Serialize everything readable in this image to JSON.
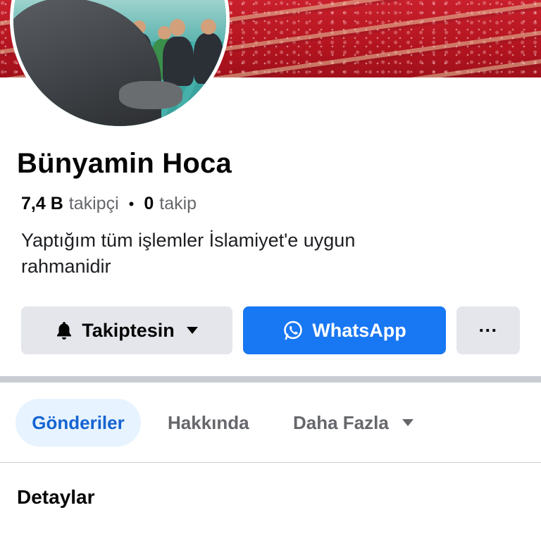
{
  "profile": {
    "name": "Bünyamin Hoca",
    "followers_count": "7,4 B",
    "followers_label": "takipçi",
    "separator": "•",
    "following_count": "0",
    "following_label": "takip",
    "bio_line1": "Yaptığım tüm işlemler İslamiyet'e uygun",
    "bio_line2": "rahmanidir"
  },
  "actions": {
    "follow_label": "Takiptesin",
    "follow_icon": "bell-icon",
    "whatsapp_label": "WhatsApp",
    "whatsapp_icon": "whatsapp-icon",
    "more_label": "···"
  },
  "tabs": [
    {
      "label": "Gönderiler",
      "active": true
    },
    {
      "label": "Hakkında",
      "active": false
    },
    {
      "label": "Daha Fazla",
      "active": false
    }
  ],
  "section": {
    "title": "Detaylar"
  },
  "colors": {
    "accent": "#1877f2",
    "active_tab_bg": "#e7f3ff",
    "active_tab_text": "#1564d2",
    "secondary_button": "#e4e6eb"
  }
}
